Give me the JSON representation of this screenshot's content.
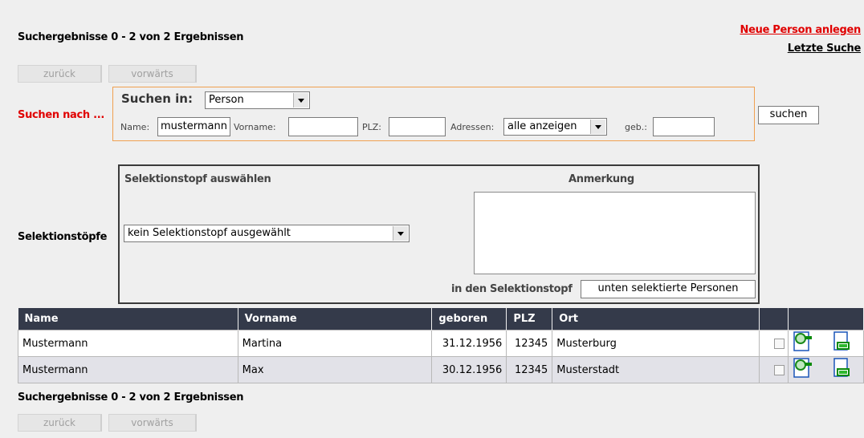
{
  "header": {
    "result_count": "Suchergebnisse 0 - 2 von 2 Ergebnissen",
    "new_person_link": "Neue Person anlegen",
    "last_search_link": "Letzte Suche"
  },
  "pager": {
    "back_label": "zurück",
    "forward_label": "vorwärts"
  },
  "search": {
    "section_label": "Suchen nach ...",
    "search_in_label": "Suchen in:",
    "search_in_value": "Person",
    "name_label": "Name:",
    "name_value": "mustermann",
    "firstname_label": "Vorname:",
    "firstname_value": "",
    "zip_label": "PLZ:",
    "zip_value": "",
    "addresses_label": "Adressen:",
    "addresses_value": "alle anzeigen",
    "birth_label": "geb.:",
    "birth_value": "",
    "submit_label": "suchen"
  },
  "selection": {
    "section_label": "Selektionstöpfe",
    "choose_heading": "Selektionstopf auswählen",
    "note_heading": "Anmerkung",
    "pot_value": "kein Selektionstopf ausgewählt",
    "into_pot_label": "in den Selektionstopf",
    "add_button_label": "unten selektierte Personen"
  },
  "table": {
    "columns": [
      "Name",
      "Vorname",
      "geboren",
      "PLZ",
      "Ort",
      "",
      ""
    ],
    "rows": [
      {
        "name": "Mustermann",
        "vorname": "Martina",
        "geboren": "31.12.1956",
        "plz": "12345",
        "ort": "Musterburg",
        "checked": false
      },
      {
        "name": "Mustermann",
        "vorname": "Max",
        "geboren": "30.12.1956",
        "plz": "12345",
        "ort": "Musterstadt",
        "checked": false
      }
    ]
  },
  "footer": {
    "result_count": "Suchergebnisse 0 - 2 von 2 Ergebnissen"
  },
  "icons": {
    "view": "search-person-icon",
    "edit": "edit-document-icon"
  },
  "colors": {
    "accent_red": "#e00000",
    "table_header": "#343a4a",
    "search_border": "#f0a050"
  }
}
